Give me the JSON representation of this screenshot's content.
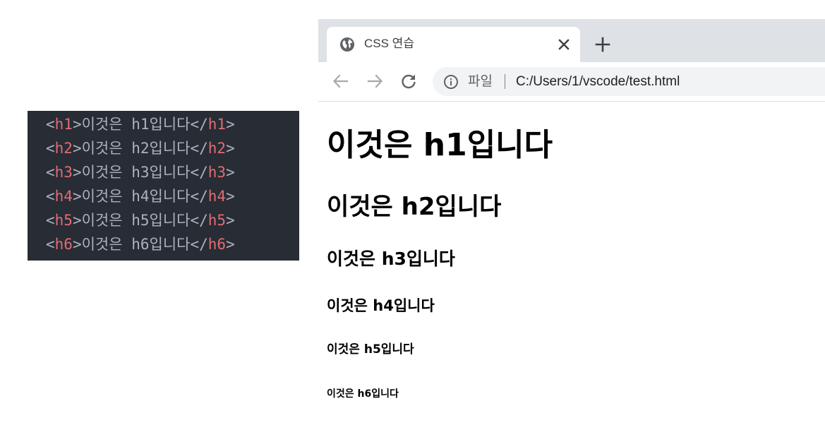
{
  "code": {
    "lines": [
      {
        "open": "h1",
        "text": "이것은 h1입니다",
        "close": "h1"
      },
      {
        "open": "h2",
        "text": "이것은 h2입니다",
        "close": "h2"
      },
      {
        "open": "h3",
        "text": "이것은 h3입니다",
        "close": "h3"
      },
      {
        "open": "h4",
        "text": "이것은 h4입니다",
        "close": "h4"
      },
      {
        "open": "h5",
        "text": "이것은 h5입니다",
        "close": "h5"
      },
      {
        "open": "h6",
        "text": "이것은 h6입니다",
        "close": "h6"
      }
    ],
    "lt": "<",
    "gt": ">",
    "lt_slash": "</",
    "colors": {
      "background": "#282c34",
      "tag": "#e06c75",
      "text": "#abb2bf"
    }
  },
  "browser": {
    "tab": {
      "title": "CSS 연습",
      "icon": "globe-icon",
      "close_icon": "close-icon"
    },
    "new_tab_icon": "plus-icon",
    "toolbar": {
      "back_icon": "arrow-left-icon",
      "forward_icon": "arrow-right-icon",
      "reload_icon": "reload-icon"
    },
    "omnibox": {
      "info_icon": "info-icon",
      "site_label": "파일",
      "url": "C:/Users/1/vscode/test.html"
    }
  },
  "page": {
    "headings": {
      "h1": "이것은 h1입니다",
      "h2": "이것은 h2입니다",
      "h3": "이것은 h3입니다",
      "h4": "이것은 h4입니다",
      "h5": "이것은 h5입니다",
      "h6": "이것은 h6입니다"
    }
  }
}
